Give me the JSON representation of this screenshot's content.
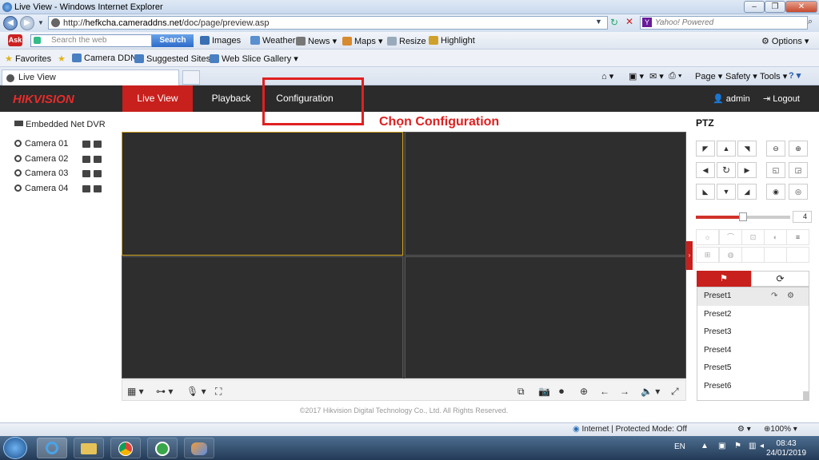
{
  "window": {
    "title": "Live View - Windows Internet Explorer"
  },
  "address": {
    "url_prefix": "http://",
    "url_host": "hefkcha.cameraddns.net",
    "url_path": "/doc/page/preview.asp",
    "search_placeholder": "Yahoo! Powered"
  },
  "ask_toolbar": {
    "search_placeholder": "Search the web",
    "search_button": "Search",
    "items": [
      "Images",
      "Weather",
      "News",
      "Maps",
      "Resize",
      "Highlight"
    ],
    "options": "Options"
  },
  "favorites_bar": {
    "favorites": "Favorites",
    "items": [
      "Camera DDNS",
      "Suggested Sites",
      "Web Slice Gallery"
    ]
  },
  "tabs": {
    "active": "Live View",
    "commands": [
      "Page",
      "Safety",
      "Tools"
    ]
  },
  "hik": {
    "logo": "HIKVISION",
    "nav": [
      "Live View",
      "Playback",
      "Configuration"
    ],
    "user": "admin",
    "logout": "Logout",
    "annotation": "Chọn Configuration",
    "device": "Embedded Net DVR",
    "cameras": [
      "Camera 01",
      "Camera 02",
      "Camera 03",
      "Camera 04"
    ],
    "copyright": "©2017 Hikvision Digital Technology Co., Ltd. All Rights Reserved.",
    "ptz": {
      "title": "PTZ",
      "speed": 4,
      "presets": [
        "Preset1",
        "Preset2",
        "Preset3",
        "Preset4",
        "Preset5",
        "Preset6"
      ]
    }
  },
  "statusbar": {
    "zone": "Internet | Protected Mode: Off",
    "zoom": "100%"
  },
  "taskbar": {
    "lang": "EN",
    "time": "08:43",
    "date": "24/01/2019"
  },
  "colors": {
    "accent": "#c8201d",
    "header": "#2b2b2b",
    "annotation": "#e02020"
  }
}
